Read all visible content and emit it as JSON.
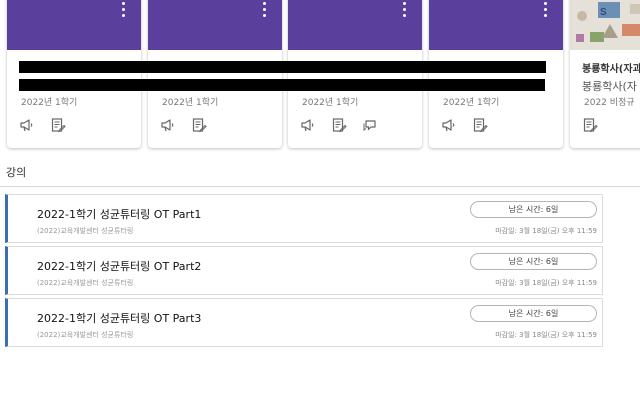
{
  "courses": [
    {
      "term": "2022년 1학기",
      "icons": [
        "announcement-icon",
        "assignment-icon"
      ]
    },
    {
      "term": "2022년 1학기",
      "icons": [
        "announcement-icon",
        "assignment-icon"
      ]
    },
    {
      "term": "2022년 1학기",
      "icons": [
        "announcement-icon",
        "assignment-icon",
        "discussion-icon"
      ]
    },
    {
      "term": "2022년 1학기",
      "icons": [
        "announcement-icon",
        "assignment-icon"
      ]
    },
    {
      "title": "봉룡학사(자과",
      "subtitle": "봉룡학사(자",
      "term": "2022 비정규",
      "icons": [
        "assignment-icon"
      ]
    }
  ],
  "lectures_section": {
    "title": "강의",
    "items": [
      {
        "title": "2022-1학기 성균튜터링 OT Part1",
        "organizer": "(2022)교육개발센터 성균튜터링",
        "remaining": "남은 시간: 6일",
        "deadline": "마감일: 3월 18일(금) 오후 11:59"
      },
      {
        "title": "2022-1학기 성균튜터링 OT Part2",
        "organizer": "(2022)교육개발센터 성균튜터링",
        "remaining": "남은 시간: 6일",
        "deadline": "마감일: 3월 18일(금) 오후 11:59"
      },
      {
        "title": "2022-1학기 성균튜터링 OT Part3",
        "organizer": "(2022)교육개발센터 성균튜터링",
        "remaining": "남은 시간: 6일",
        "deadline": "마감일: 3월 18일(금) 오후 11:59"
      }
    ]
  },
  "colors": {
    "card_banner": "#5a3f9c",
    "lecture_accent": "#3a6db5"
  }
}
